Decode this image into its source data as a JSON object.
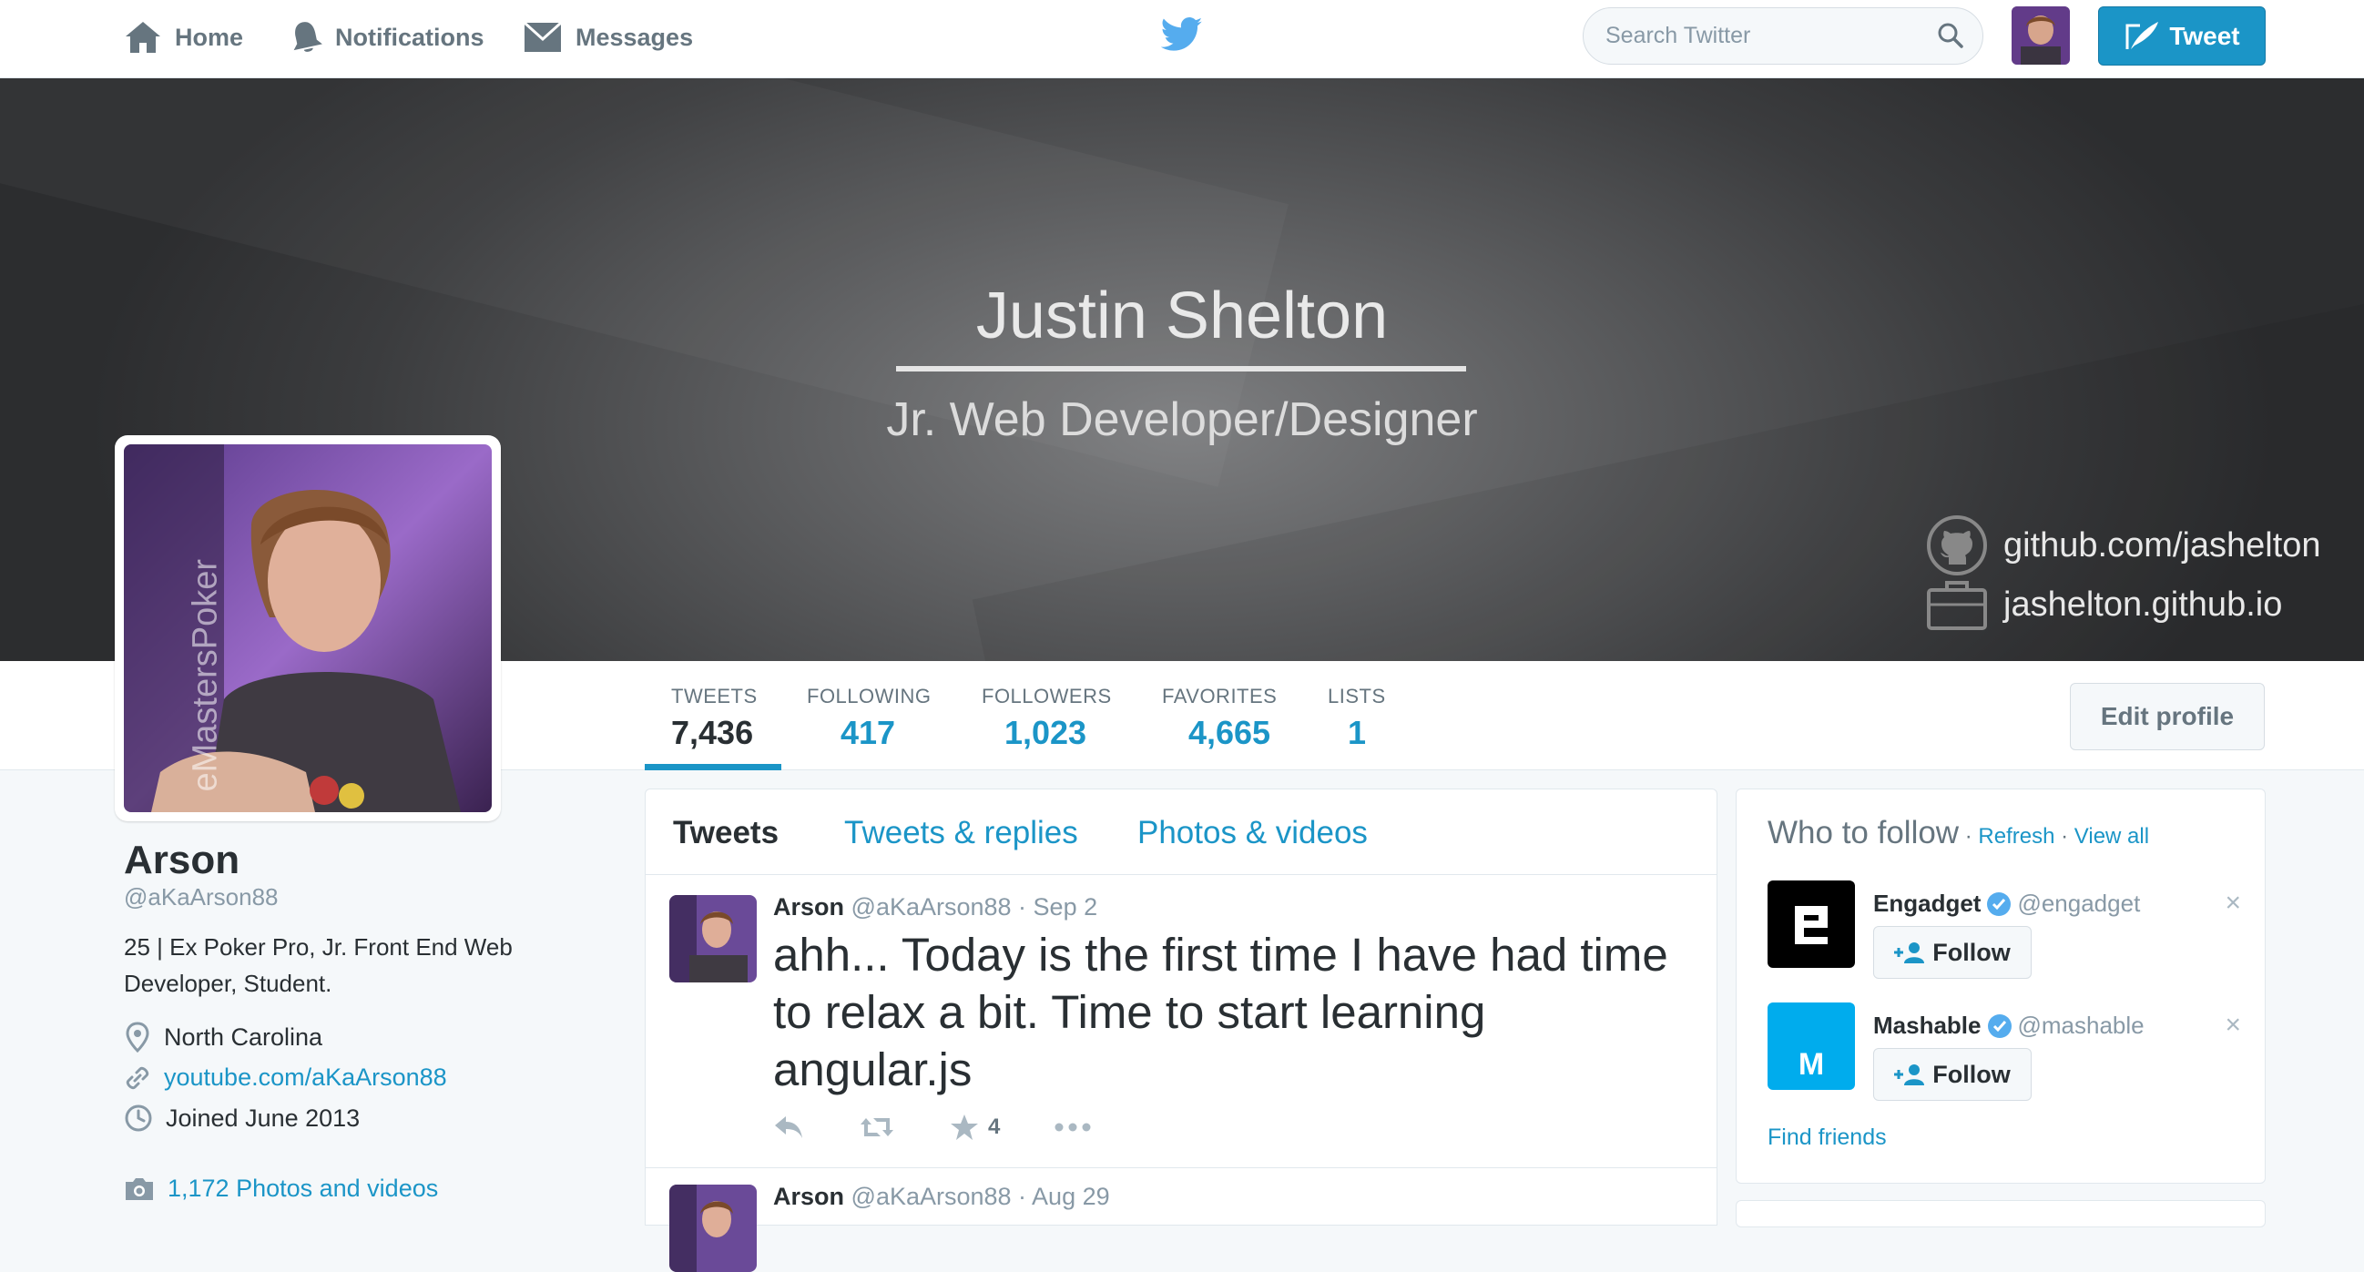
{
  "nav": {
    "home_label": "Home",
    "notifications_label": "Notifications",
    "messages_label": "Messages",
    "search_placeholder": "Search Twitter",
    "tweet_button_label": "Tweet"
  },
  "banner": {
    "name": "Justin Shelton",
    "role": "Jr. Web Developer/Designer",
    "github": "github.com/jashelton",
    "website": "jashelton.github.io"
  },
  "avatar_watermark": "eMastersPoker",
  "stats": [
    {
      "label": "TWEETS",
      "value": "7,436"
    },
    {
      "label": "FOLLOWING",
      "value": "417"
    },
    {
      "label": "FOLLOWERS",
      "value": "1,023"
    },
    {
      "label": "FAVORITES",
      "value": "4,665"
    },
    {
      "label": "LISTS",
      "value": "1"
    }
  ],
  "edit_profile_label": "Edit profile",
  "profile": {
    "name": "Arson",
    "handle": "@aKaArson88",
    "bio": "25 | Ex Poker Pro, Jr. Front End Web Developer, Student.",
    "location": "North Carolina",
    "website": "youtube.com/aKaArson88",
    "joined": "Joined June 2013",
    "photos": "1,172 Photos and videos"
  },
  "timeline": {
    "tabs": [
      "Tweets",
      "Tweets & replies",
      "Photos & videos"
    ],
    "tweets": [
      {
        "name": "Arson",
        "handle": "@aKaArson88 · Sep 2",
        "text": "ahh... Today is the first time I have had time to relax a bit.  Time to start learning angular.js",
        "favorites": "4"
      },
      {
        "name": "Arson",
        "handle": "@aKaArson88 · Aug 29"
      }
    ]
  },
  "who_to_follow": {
    "title": "Who to follow",
    "sep": " · ",
    "refresh": "Refresh",
    "view_all": "View all",
    "follow_label": "Follow",
    "close_glyph": "×",
    "find_friends": "Find friends",
    "suggestions": [
      {
        "name": "Engadget",
        "handle": "@engadget",
        "logo_letter": "e"
      },
      {
        "name": "Mashable",
        "handle": "@mashable",
        "logo_letter": "M"
      }
    ]
  },
  "colors": {
    "accent": "#1b95c7",
    "text": "#292f33",
    "muted": "#8899a6",
    "background": "#f5f8fa"
  }
}
